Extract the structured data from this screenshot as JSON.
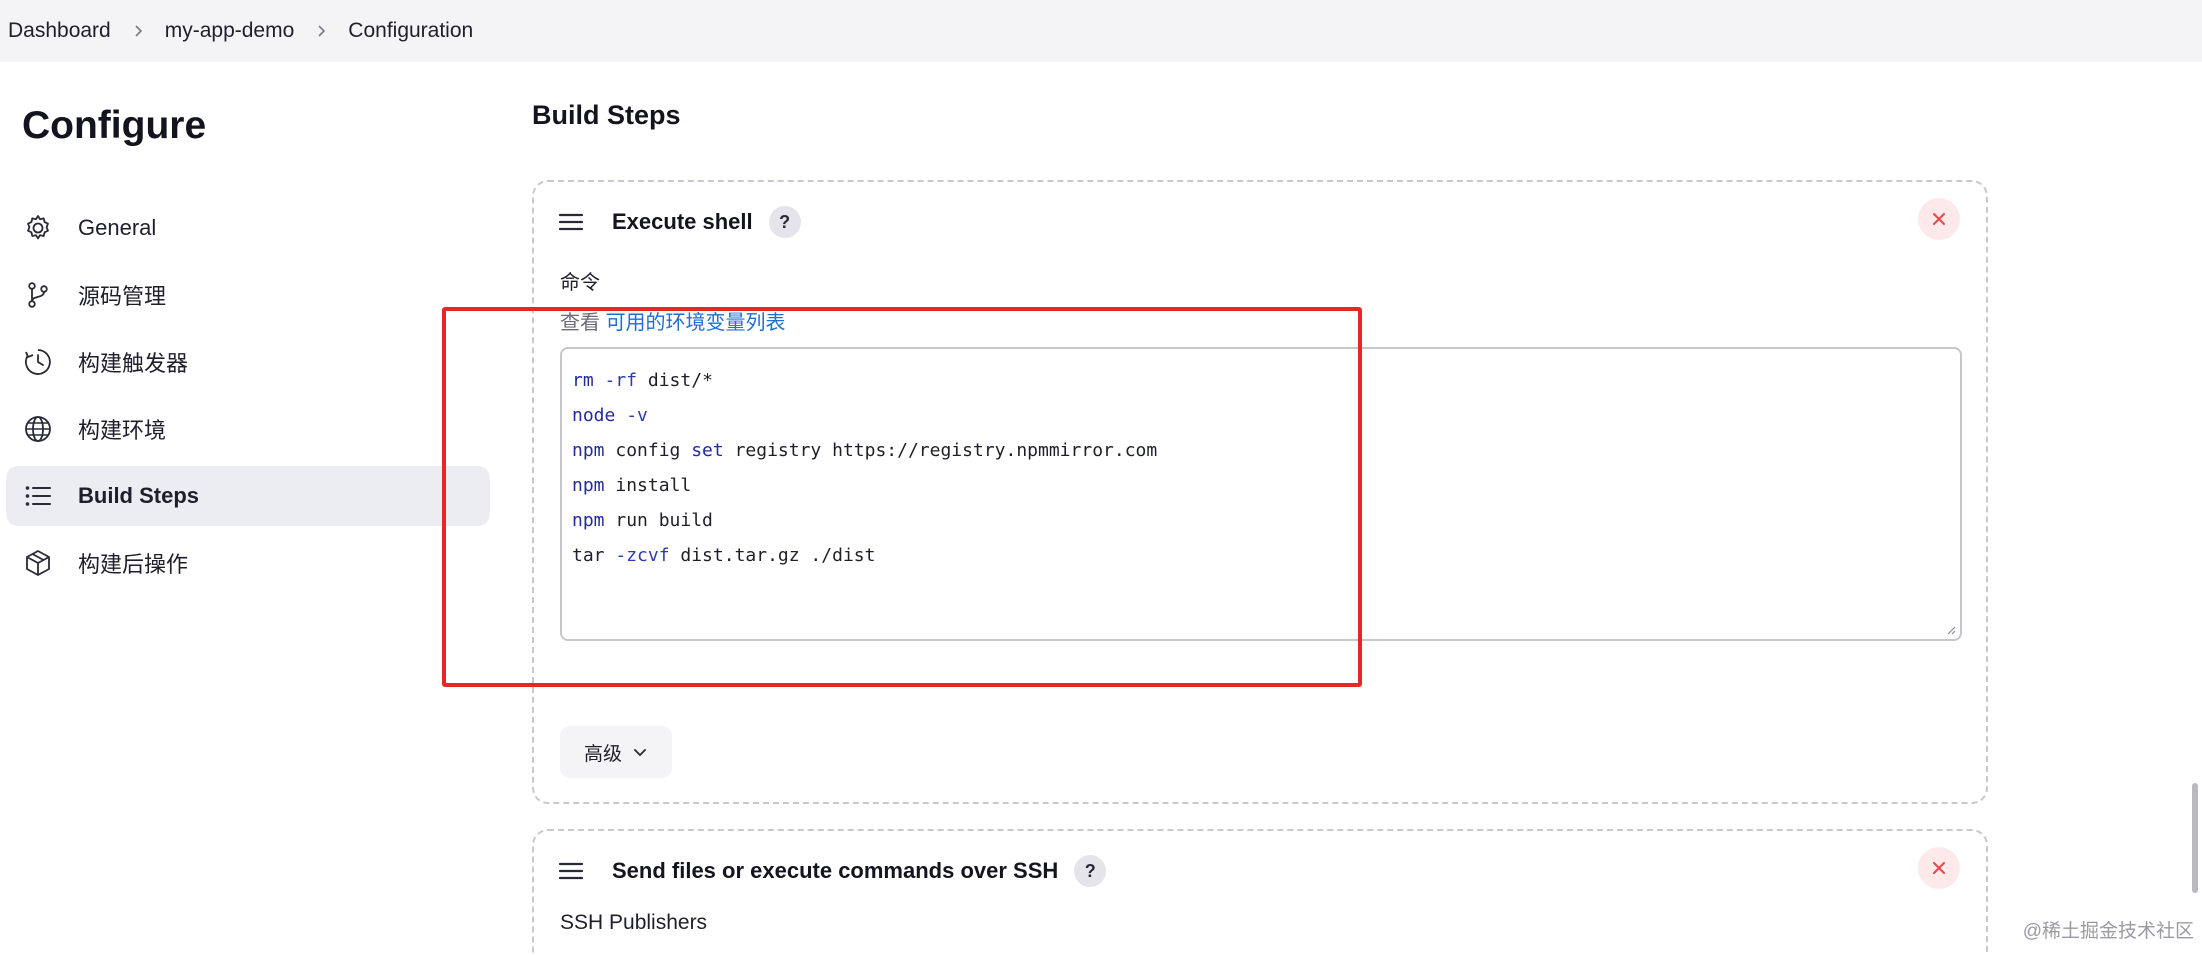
{
  "breadcrumb": {
    "items": [
      "Dashboard",
      "my-app-demo",
      "Configuration"
    ]
  },
  "page": {
    "title": "Configure"
  },
  "sidebar": {
    "items": [
      {
        "label": "General",
        "icon": "gear-icon"
      },
      {
        "label": "源码管理",
        "icon": "branch-icon"
      },
      {
        "label": "构建触发器",
        "icon": "clock-icon"
      },
      {
        "label": "构建环境",
        "icon": "globe-icon"
      },
      {
        "label": "Build Steps",
        "icon": "list-icon",
        "active": true
      },
      {
        "label": "构建后操作",
        "icon": "package-icon"
      }
    ]
  },
  "main": {
    "section_title": "Build Steps",
    "steps": [
      {
        "title": "Execute shell",
        "help": "?",
        "command_label": "命令",
        "env_prefix": "查看",
        "env_link": "可用的环境变量列表",
        "command_lines": [
          {
            "cmd": "rm",
            "flag": "-rf",
            "rest": " dist/*"
          },
          {
            "cmd": "node",
            "flag": "-v",
            "rest": ""
          },
          {
            "cmd": "npm",
            "plain": " config ",
            "kw2": "set",
            "rest": " registry https://registry.npmmirror.com"
          },
          {
            "cmd": "npm",
            "rest": " install"
          },
          {
            "cmd": "npm",
            "rest": " run build"
          },
          {
            "plain_cmd": "tar",
            "flag": "-zcvf",
            "rest": " dist.tar.gz ./dist"
          }
        ],
        "advanced_label": "高级"
      },
      {
        "title": "Send files or execute commands over SSH",
        "help": "?",
        "sub_label": "SSH Publishers"
      }
    ]
  },
  "watermark": "@稀土掘金技术社区",
  "colors": {
    "accent_link": "#1e6fd0",
    "annotation_red": "#e8262a",
    "close_red": "#e5484d"
  }
}
